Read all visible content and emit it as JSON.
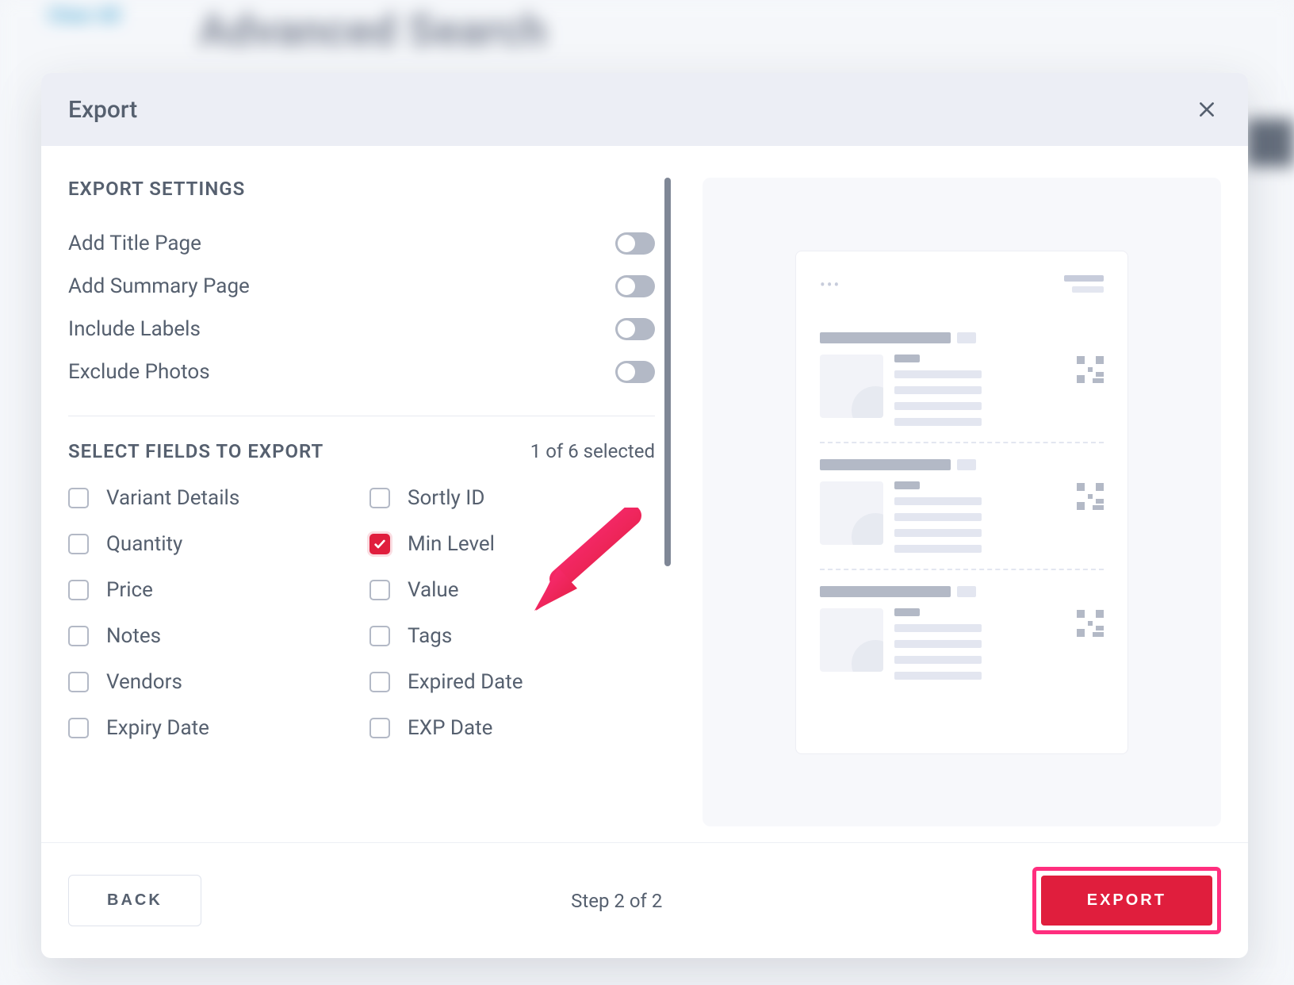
{
  "background": {
    "clear_all": "Clear All",
    "page_title": "Advanced Search"
  },
  "modal": {
    "title": "Export",
    "settings": {
      "heading": "EXPORT SETTINGS",
      "items": [
        {
          "label": "Add Title Page",
          "on": false
        },
        {
          "label": "Add Summary Page",
          "on": false
        },
        {
          "label": "Include Labels",
          "on": false
        },
        {
          "label": "Exclude Photos",
          "on": false
        }
      ]
    },
    "fields": {
      "heading": "SELECT FIELDS TO EXPORT",
      "selected_text": "1 of 6 selected",
      "items": [
        {
          "label": "Variant Details",
          "checked": false
        },
        {
          "label": "Sortly ID",
          "checked": false
        },
        {
          "label": "Quantity",
          "checked": false
        },
        {
          "label": "Min Level",
          "checked": true
        },
        {
          "label": "Price",
          "checked": false
        },
        {
          "label": "Value",
          "checked": false
        },
        {
          "label": "Notes",
          "checked": false
        },
        {
          "label": "Tags",
          "checked": false
        },
        {
          "label": "Vendors",
          "checked": false
        },
        {
          "label": "Expired Date",
          "checked": false
        },
        {
          "label": "Expiry Date",
          "checked": false
        },
        {
          "label": "EXP Date",
          "checked": false
        }
      ]
    },
    "footer": {
      "back": "BACK",
      "step": "Step 2 of 2",
      "export": "EXPORT"
    }
  }
}
